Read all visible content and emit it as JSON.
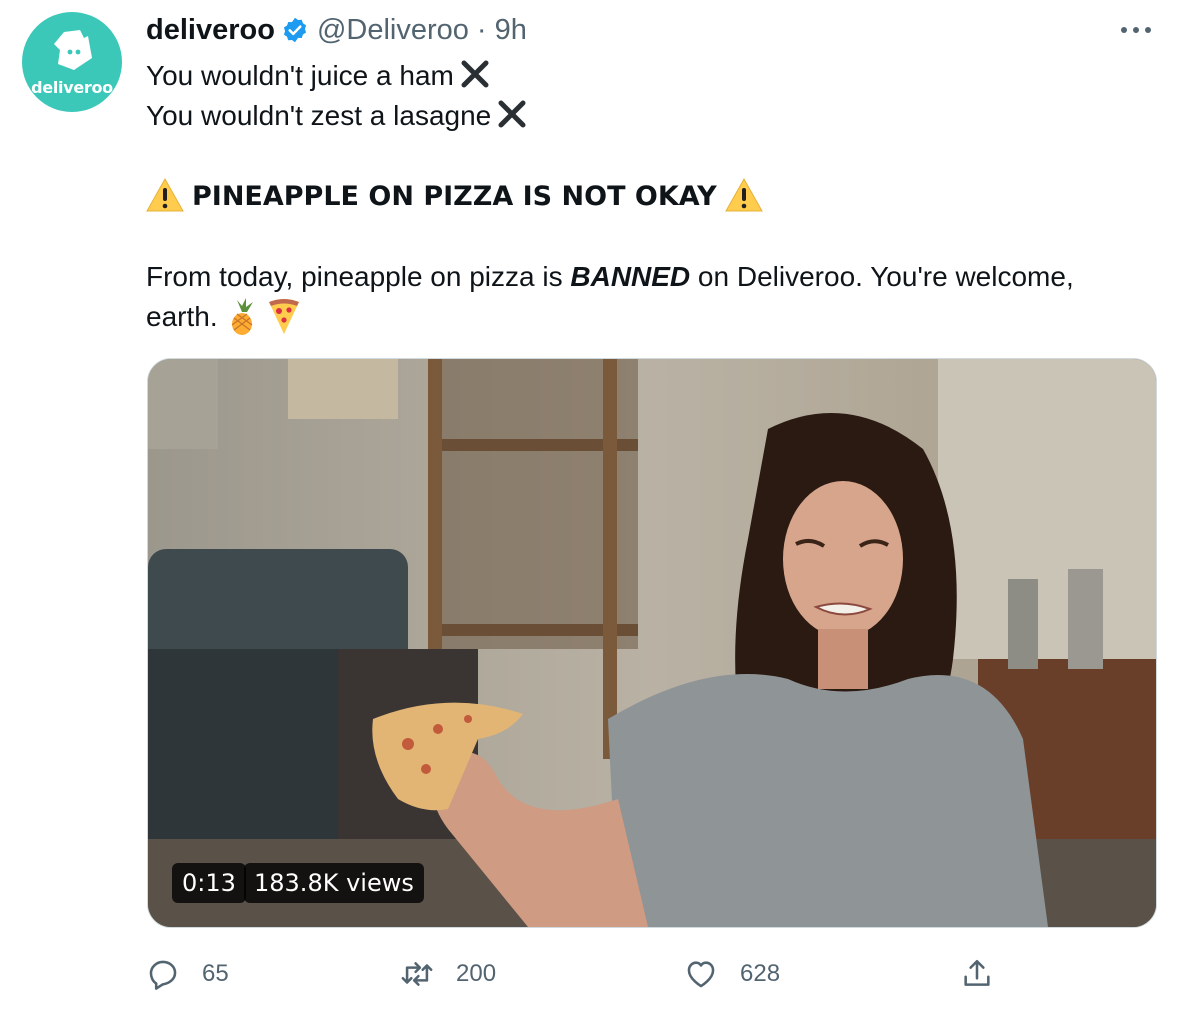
{
  "tweet": {
    "display_name": "deliveroo",
    "handle": "@Deliveroo",
    "separator": "·",
    "time": "9h",
    "avatar_text": "deliveroo",
    "line1": "You wouldn't juice a ham",
    "line2": "You wouldn't zest a lasagne",
    "headline": "PINEAPPLE ON PIZZA IS NOT OKAY",
    "body_pre": "From today, pineapple on pizza is ",
    "body_bold": "BANNED",
    "body_post": " on Deliveroo. You're welcome, earth.",
    "emojis": [
      "pineapple-emoji",
      "pizza-emoji"
    ]
  },
  "media": {
    "type": "video",
    "duration": "0:13",
    "views": "183.8K views"
  },
  "actions": {
    "replies": "65",
    "retweets": "200",
    "likes": "628"
  },
  "colors": {
    "brand": "#3cc8b9",
    "verified": "#1d9bf0",
    "muted": "#536471",
    "text": "#0f1419"
  },
  "icons": [
    "more-icon",
    "verified-badge-icon",
    "x-mark-icon",
    "warning-icon",
    "reply-icon",
    "retweet-icon",
    "like-icon",
    "share-icon"
  ]
}
